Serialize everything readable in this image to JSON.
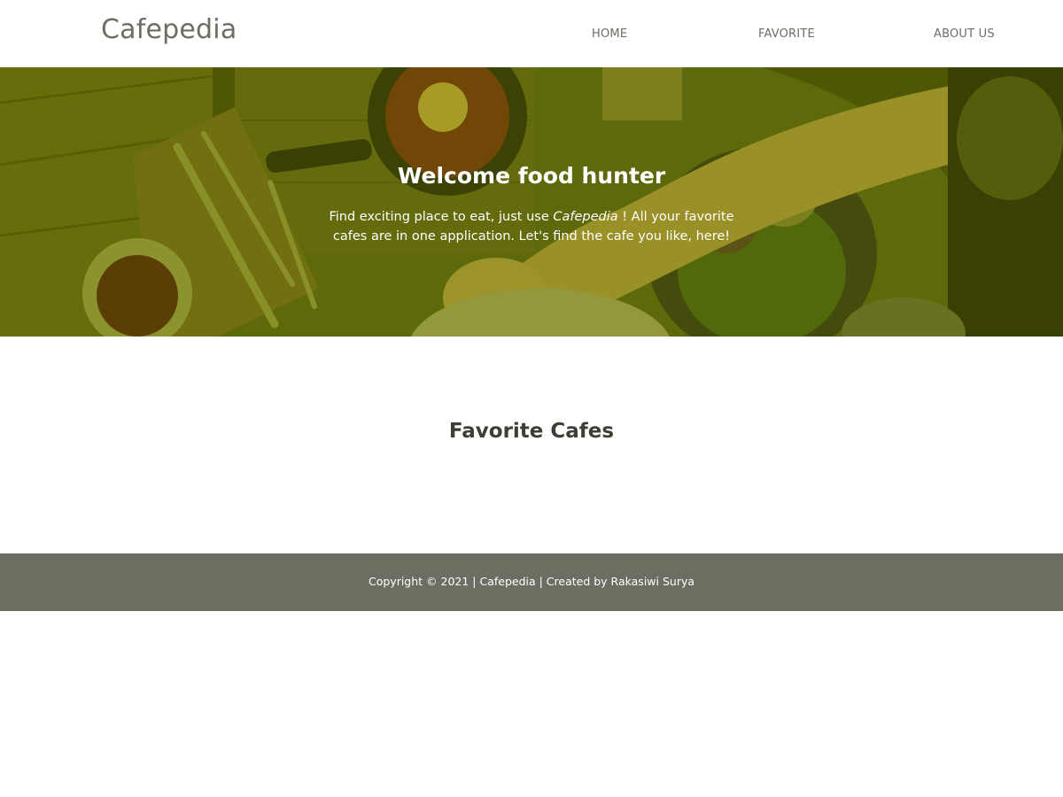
{
  "header": {
    "brand": "Cafepedia",
    "nav": [
      {
        "label": "HOME"
      },
      {
        "label": "FAVORITE"
      },
      {
        "label": "ABOUT US"
      }
    ]
  },
  "hero": {
    "title": "Welcome food hunter",
    "text_before": "Find exciting place to eat, just use ",
    "brand_em": "Cafepedia",
    "text_after": " ! All your favorite cafes are in one application. Let's find the cafe you like, here!"
  },
  "main": {
    "section_title": "Favorite Cafes"
  },
  "footer": {
    "copyright": "Copyright © 2021 | Cafepedia | Created by Rakasiwi Surya"
  },
  "colors": {
    "brand_gray": "#6c6e62",
    "hero_tint": "#5e6600",
    "text_dark": "#3d3f36"
  }
}
